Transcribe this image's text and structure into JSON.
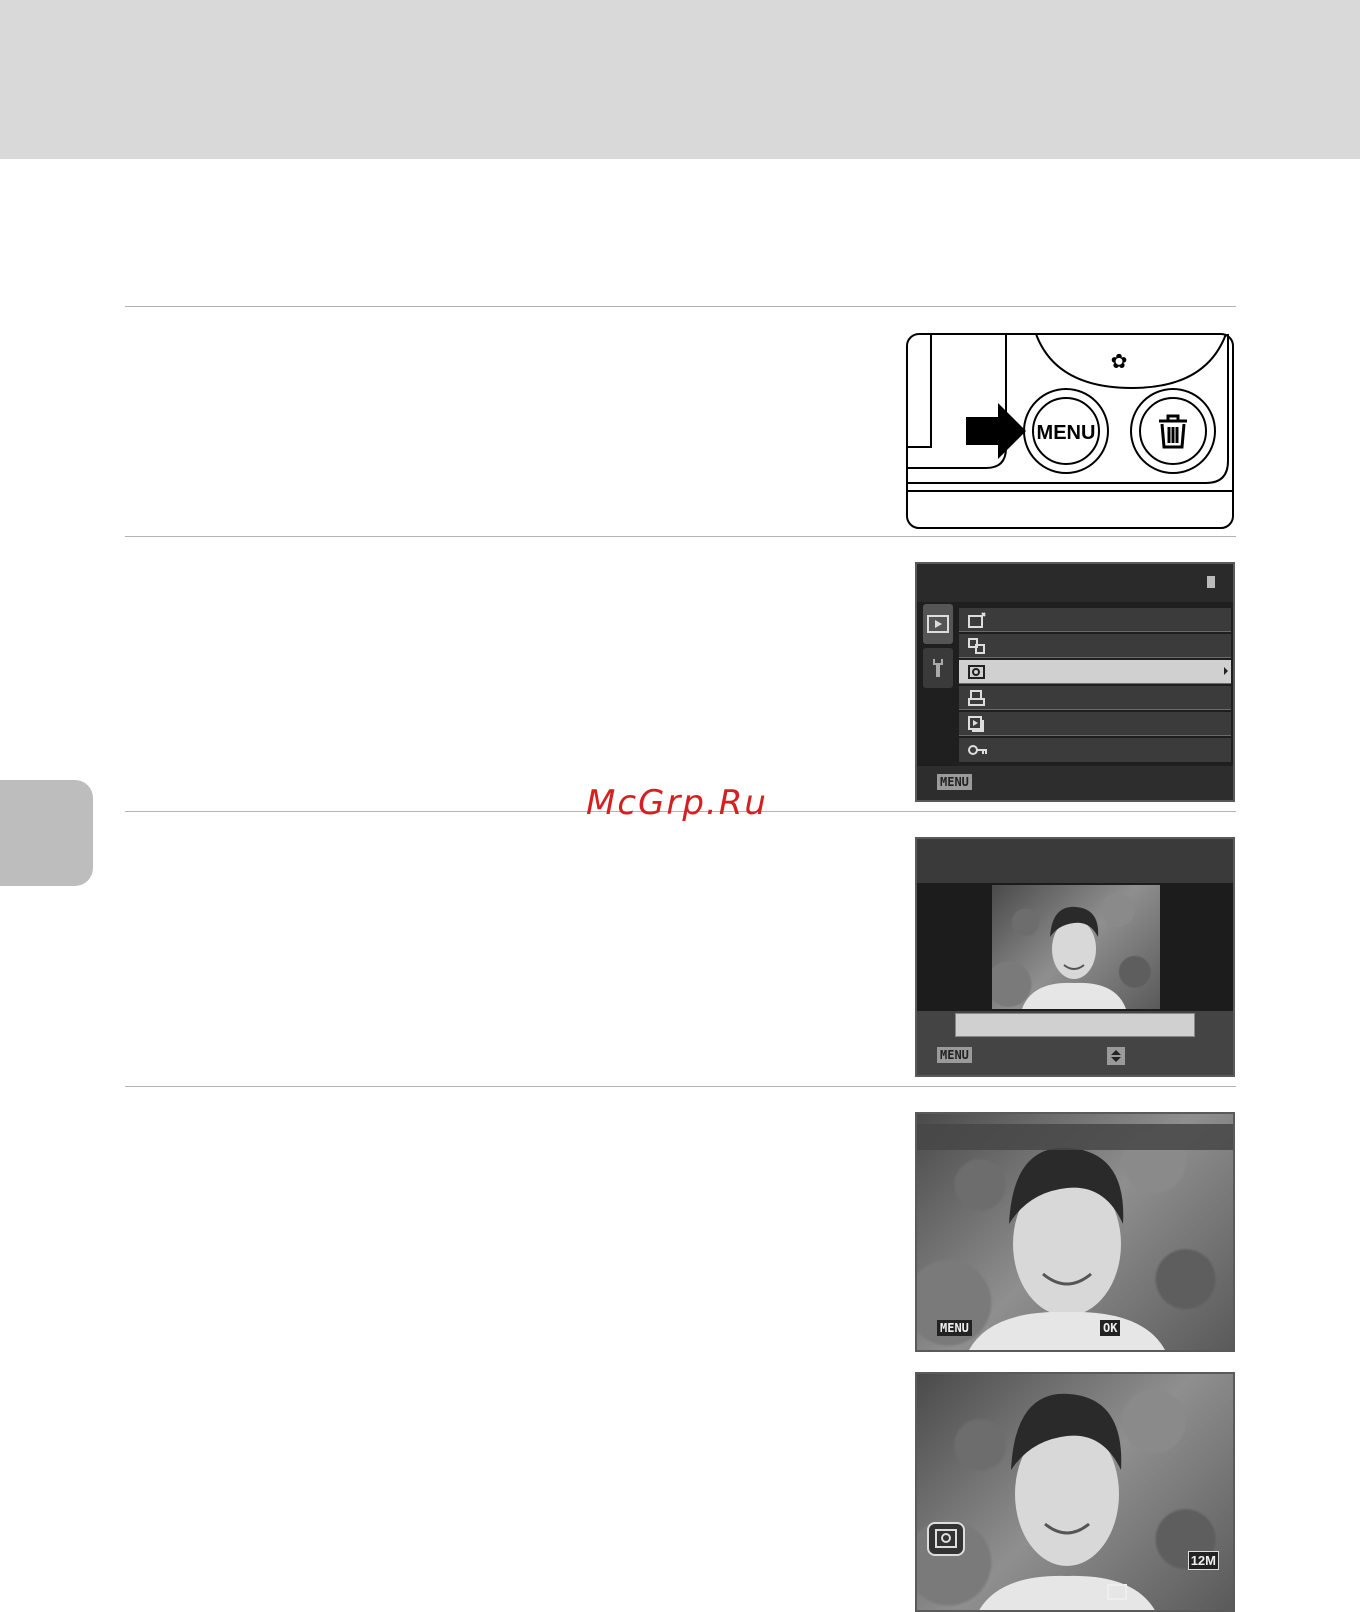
{
  "watermark": "McGrp.Ru",
  "camera_buttons": {
    "menu_label": "MENU"
  },
  "playback_menu": {
    "footer_button": "MENU"
  },
  "skin_softening_screen": {
    "footer_button": "MENU"
  },
  "confirm_screen": {
    "left_button": "MENU",
    "right_button": "OK"
  },
  "result_screen": {
    "image_size": "12M"
  },
  "colors": {
    "page_band": "#d9d9d9",
    "side_tab": "#bdbdbd",
    "rule": "#b3b3b3",
    "watermark": "#d42020",
    "lcd_background": "#1f1f1f"
  }
}
